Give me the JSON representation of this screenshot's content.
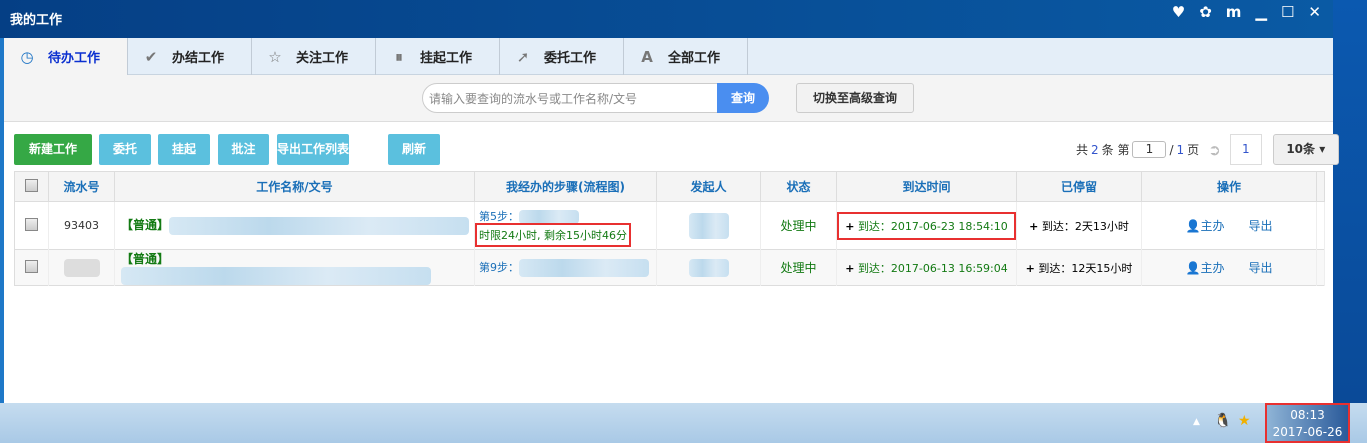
{
  "window": {
    "title": "我的工作",
    "controls": [
      "heart-icon",
      "settings-icon",
      "book-icon",
      "minimize-icon",
      "maximize-icon",
      "close-icon"
    ]
  },
  "tabs": [
    {
      "label": "待办工作",
      "icon": "clock-icon",
      "active": true
    },
    {
      "label": "办结工作",
      "icon": "check-icon"
    },
    {
      "label": "关注工作",
      "icon": "star-icon"
    },
    {
      "label": "挂起工作",
      "icon": "pause-icon"
    },
    {
      "label": "委托工作",
      "icon": "arrow-icon"
    },
    {
      "label": "全部工作",
      "icon": "letter-a-icon"
    }
  ],
  "search": {
    "placeholder": "请输入要查询的流水号或工作名称/文号",
    "button": "查询",
    "advanced": "切换至高级查询"
  },
  "toolbar": {
    "new": "新建工作",
    "delegate": "委托",
    "suspend": "挂起",
    "comment": "批注",
    "export": "导出工作列表",
    "refresh": "刷新"
  },
  "pager": {
    "total_prefix": "共",
    "total": "2",
    "total_suffix": "条 第",
    "page": "1",
    "pages_prefix": "/",
    "pages": "1",
    "pages_suffix": "页",
    "goto": "1",
    "per_page": "10条"
  },
  "table": {
    "headers": [
      "流水号",
      "工作名称/文号",
      "我经办的步骤(流程图)",
      "发起人",
      "状态",
      "到达时间",
      "已停留",
      "操作"
    ],
    "rows": [
      {
        "id": "93403",
        "tag": "【普通】",
        "step": "第5步：",
        "limit": "时限24小时, 剩余15小时46分",
        "status": "处理中",
        "arrive": "到达：2017-06-23 18:54:10",
        "stay": "到达：2天13小时",
        "action1": "主办",
        "action2": "导出"
      },
      {
        "id": "",
        "tag": "【普通】",
        "step": "第9步：",
        "status": "处理中",
        "arrive": "到达：2017-06-13 16:59:04",
        "stay": "到达：12天15小时",
        "action1": "主办",
        "action2": "导出"
      }
    ]
  },
  "taskbar": {
    "time": "08:13",
    "date": "2017-06-26"
  }
}
